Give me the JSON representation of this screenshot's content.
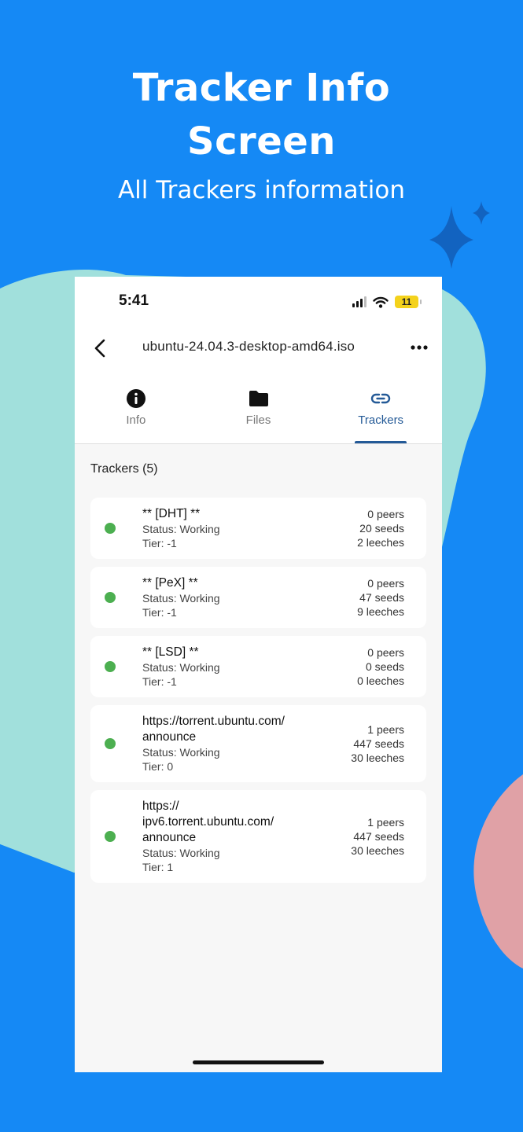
{
  "hero": {
    "title": "Tracker Info\nScreen",
    "subtitle": "All Trackers information"
  },
  "status_bar": {
    "time": "5:41",
    "battery": "11"
  },
  "nav": {
    "title": "ubuntu-24.04.3-desktop-amd64.iso"
  },
  "tabs": [
    {
      "label": "Info",
      "icon": "info-icon",
      "active": false
    },
    {
      "label": "Files",
      "icon": "folder-icon",
      "active": false
    },
    {
      "label": "Trackers",
      "icon": "link-icon",
      "active": true
    }
  ],
  "colors": {
    "background": "#1589f5",
    "accent": "#245a97",
    "status_working": "#4caf50",
    "blob_teal": "#a1e0dc",
    "blob_pink": "#e0a1a6"
  },
  "trackers": {
    "heading": "Trackers (5)",
    "items": [
      {
        "name": "** [DHT] **",
        "status": "Status: Working",
        "tier": "Tier: -1",
        "peers": "0 peers",
        "seeds": "20 seeds",
        "leeches": "2 leeches"
      },
      {
        "name": "** [PeX] **",
        "status": "Status: Working",
        "tier": "Tier: -1",
        "peers": "0 peers",
        "seeds": "47 seeds",
        "leeches": "9 leeches"
      },
      {
        "name": "** [LSD] **",
        "status": "Status: Working",
        "tier": "Tier: -1",
        "peers": "0 peers",
        "seeds": "0 seeds",
        "leeches": "0 leeches"
      },
      {
        "name": "https://torrent.ubuntu.com/\nannounce",
        "status": "Status: Working",
        "tier": "Tier: 0",
        "peers": "1 peers",
        "seeds": "447 seeds",
        "leeches": "30 leeches"
      },
      {
        "name": "https://\nipv6.torrent.ubuntu.com/\nannounce",
        "status": "Status: Working",
        "tier": "Tier: 1",
        "peers": "1 peers",
        "seeds": "447 seeds",
        "leeches": "30 leeches"
      }
    ]
  }
}
